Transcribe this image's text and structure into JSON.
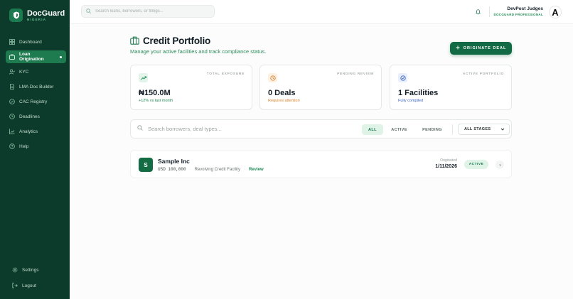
{
  "sidebar": {
    "brand": {
      "name": "DocGuard",
      "subtitle": "NIGERIA"
    },
    "items": [
      {
        "label": "Dashboard",
        "icon": "dashboard-icon"
      },
      {
        "label": "Loan Origination",
        "icon": "briefcase-icon",
        "active": true
      },
      {
        "label": "KYC",
        "icon": "user-check-icon"
      },
      {
        "label": "LMA Doc Builder",
        "icon": "document-icon"
      },
      {
        "label": "CAC Registry",
        "icon": "shield-check-icon"
      },
      {
        "label": "Deadlines",
        "icon": "clock-icon"
      },
      {
        "label": "Analytics",
        "icon": "chart-icon"
      },
      {
        "label": "Help",
        "icon": "help-icon"
      }
    ],
    "bottom": [
      {
        "label": "Settings",
        "icon": "gear-icon"
      },
      {
        "label": "Logout",
        "icon": "logout-icon"
      }
    ]
  },
  "topbar": {
    "search_placeholder": "Search loans, borrowers, or filings...",
    "user_name": "DevPost Judges",
    "user_role": "DOCGUARD PROFESSIONAL",
    "avatar_letter": "A"
  },
  "header": {
    "title": "Credit Portfolio",
    "subtitle": "Manage your active facilities and track compliance status.",
    "originate_label": "ORIGINATE DEAL"
  },
  "stats": [
    {
      "label": "TOTAL EXPOSURE",
      "value": "₦150.0M",
      "note": "+12% vs last month",
      "note_color": "#1f8a55",
      "icon": "trending-up-icon",
      "icon_color": "#1f8a55",
      "icon_bg": "#e3f4ea"
    },
    {
      "label": "PENDING REVIEW",
      "value": "0 Deals",
      "note": "Requires attention",
      "note_color": "#d9822b",
      "icon": "clock-icon",
      "icon_color": "#d9822b",
      "icon_bg": "#fdf1e4"
    },
    {
      "label": "ACTIVE PORTFOLIO",
      "value": "1 Facilities",
      "note": "Fully compiled",
      "note_color": "#3b66c4",
      "icon": "check-circle-icon",
      "icon_color": "#3b66c4",
      "icon_bg": "#e8eefb"
    }
  ],
  "filters": {
    "search_placeholder": "Search borrowers, deal types...",
    "tabs": [
      "ALL",
      "ACTIVE",
      "PENDING"
    ],
    "active_tab": "ALL",
    "stage_select": "ALL STAGES"
  },
  "deals": [
    {
      "initial": "S",
      "name": "Sample Inc",
      "amount": "USD 100,000",
      "facility": "Revolving Credit Facility",
      "action": "Review",
      "originated_label": "Originated",
      "originated_date": "1/11/2026",
      "status": "ACTIVE"
    }
  ],
  "colors": {
    "sidebar_bg": "#0d3b2b",
    "accent": "#136b45",
    "active_nav": "#1e7a4f"
  }
}
